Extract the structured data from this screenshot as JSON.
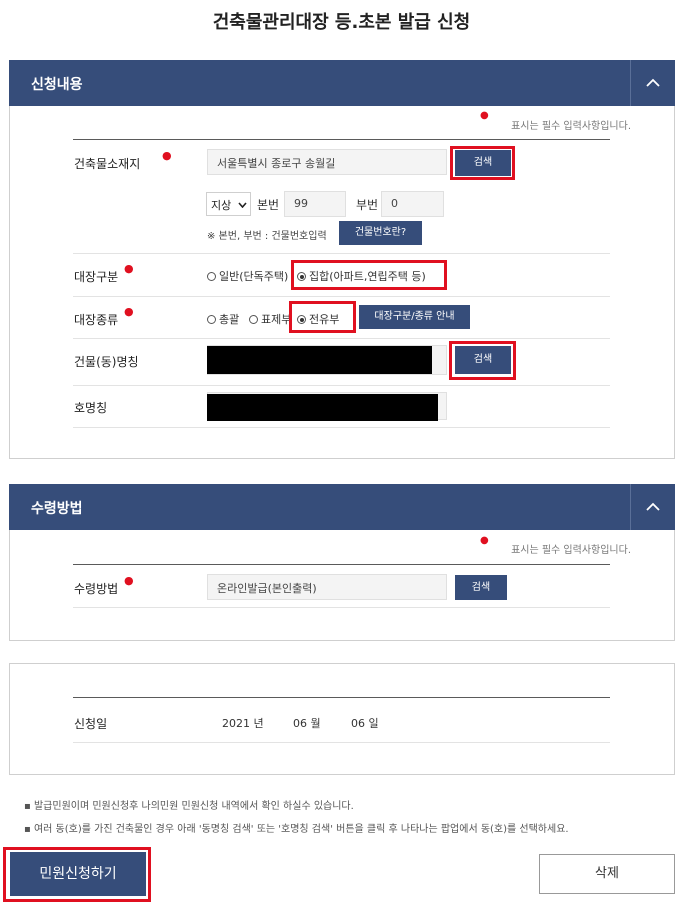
{
  "page_title": "건축물관리대장 등.초본 발급 신청",
  "required_note": "표시는 필수 입력사항입니다.",
  "section1": {
    "title": "신청내용",
    "address_label": "건축물소재지",
    "address_value": "서울특별시 종로구 송월길",
    "search_label": "검색",
    "land_type": "지상",
    "main_no_label": "본번",
    "main_no_value": "99",
    "sub_no_label": "부번",
    "sub_no_value": "0",
    "bunji_note": "※ 본번, 부번 : 건물번호입력",
    "bunji_help_btn": "건물번호란?",
    "ledger_class_label": "대장구분",
    "ledger_class_options": [
      "일반(단독주택)",
      "집합(아파트,연립주택 등)"
    ],
    "ledger_class_selected": "집합(아파트,연립주택 등)",
    "ledger_kind_label": "대장종류",
    "ledger_kind_options": [
      "총괄",
      "표제부",
      "전유부"
    ],
    "ledger_kind_selected": "전유부",
    "ledger_guide_btn": "대장구분/종류 안내",
    "building_name_label": "건물(동)명칭",
    "unit_name_label": "호명칭"
  },
  "section2": {
    "title": "수령방법",
    "method_label": "수령방법",
    "method_value": "온라인발급(본인출력)",
    "search_label": "검색"
  },
  "section3": {
    "date_label": "신청일",
    "year": "2021",
    "year_unit": "년",
    "month": "06",
    "month_unit": "월",
    "day": "06",
    "day_unit": "일"
  },
  "notes": [
    "발급민원이며 민원신청후 나의민원 민원신청 내역에서 확인 하실수 있습니다.",
    "여러 동(호)를 가진 건축물인 경우 아래 '동명칭 검색' 또는 '호명칭 검색' 버튼을 클릭 후 나타나는 팝업에서 동(호)를 선택하세요."
  ],
  "submit_label": "민원신청하기",
  "delete_label": "삭제",
  "colors": {
    "header_navy": "#364d7a",
    "highlight_red": "#e01020",
    "required_dot": "#e01020"
  },
  "icons": {
    "collapse": "chevron-up-icon"
  }
}
